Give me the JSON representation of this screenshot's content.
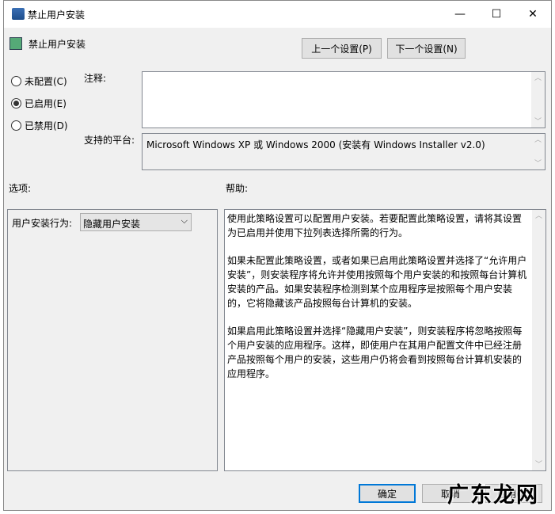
{
  "window": {
    "title": "禁止用户安装",
    "minimize": "—",
    "maximize": "☐",
    "close": "✕"
  },
  "header": {
    "policy_name": "禁止用户安装",
    "prev_button": "上一个设置(P)",
    "next_button": "下一个设置(N)"
  },
  "state": {
    "options": [
      {
        "label": "未配置(C)",
        "checked": false
      },
      {
        "label": "已启用(E)",
        "checked": true
      },
      {
        "label": "已禁用(D)",
        "checked": false
      }
    ]
  },
  "comment": {
    "label": "注释:",
    "value": ""
  },
  "platform": {
    "label": "支持的平台:",
    "value": "Microsoft Windows XP 或 Windows 2000 (安装有 Windows Installer v2.0)"
  },
  "options_section": {
    "label": "选项:",
    "behavior_label": "用户安装行为:",
    "behavior_value": "隐藏用户安装"
  },
  "help_section": {
    "label": "帮助:",
    "paragraphs": [
      "使用此策略设置可以配置用户安装。若要配置此策略设置，请将其设置为已启用并使用下拉列表选择所需的行为。",
      "如果未配置此策略设置，或者如果已启用此策略设置并选择了“允许用户安装”，则安装程序将允许并使用按照每个用户安装的和按照每台计算机安装的产品。如果安装程序检测到某个应用程序是按照每个用户安装的，它将隐藏该产品按照每台计算机的安装。",
      "如果启用此策略设置并选择“隐藏用户安装”，则安装程序将忽略按照每个用户安装的应用程序。这样，即使用户在其用户配置文件中已经注册产品按照每个用户的安装，这些用户仍将会看到按照每台计算机安装的应用程序。"
    ]
  },
  "footer": {
    "ok": "确定",
    "cancel": "取消",
    "apply": "应用(A)"
  },
  "watermark": "广东龙网"
}
